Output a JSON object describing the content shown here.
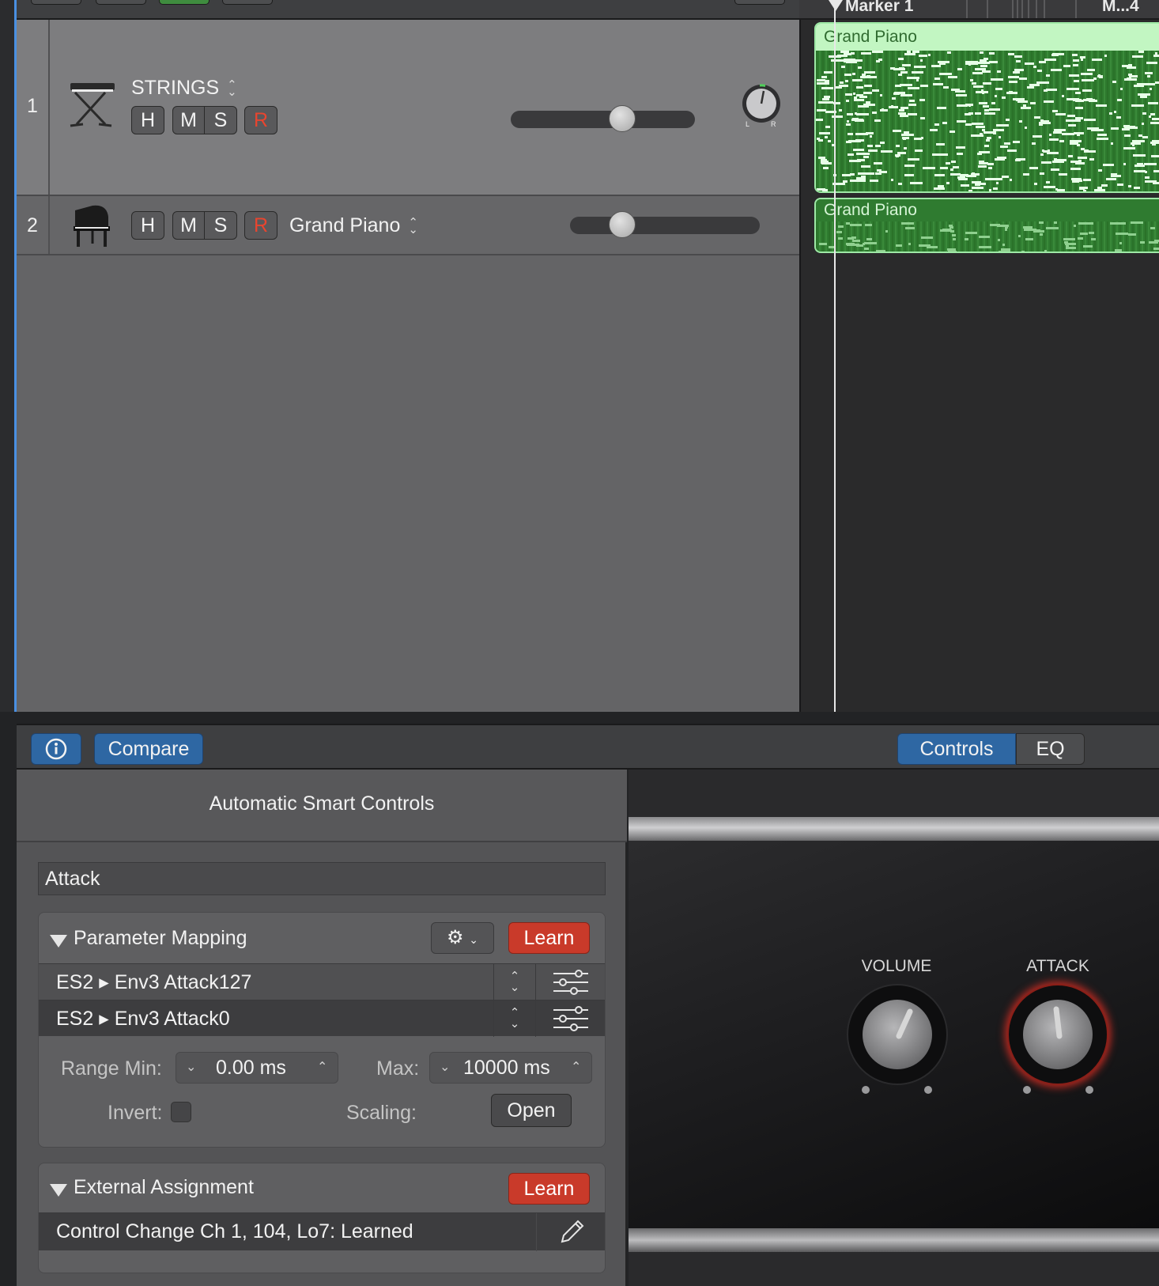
{
  "ruler": {
    "markers": [
      "Marker 1",
      "M...4"
    ]
  },
  "tracks": [
    {
      "number": "1",
      "name": "STRINGS",
      "buttons": {
        "hide": "H",
        "mute": "M",
        "solo": "S",
        "record": "R"
      },
      "pan_labels": {
        "left": "L",
        "right": "R"
      },
      "volume_fraction": 0.61
    },
    {
      "number": "2",
      "name": "Grand Piano",
      "buttons": {
        "hide": "H",
        "mute": "M",
        "solo": "S",
        "record": "R"
      },
      "volume_fraction": 0.28
    }
  ],
  "regions": [
    {
      "name": "Grand Piano"
    },
    {
      "name": "Grand Piano"
    }
  ],
  "smart_controls": {
    "header": {
      "info_icon": "info-icon",
      "compare_label": "Compare",
      "tabs": [
        "Controls",
        "EQ"
      ],
      "active_tab": "Controls"
    },
    "inspector": {
      "title": "Automatic Smart Controls",
      "parameter_name": "Attack",
      "parameter_mapping": {
        "title": "Parameter Mapping",
        "learn_label": "Learn",
        "rows": [
          "ES2 ▸ Env3 Attack127",
          "ES2 ▸ Env3 Attack0"
        ],
        "range_min_label": "Range Min:",
        "range_min_value": "0.00 ms",
        "max_label": "Max:",
        "max_value": "10000 ms",
        "invert_label": "Invert:",
        "scaling_label": "Scaling:",
        "open_label": "Open"
      },
      "external_assignment": {
        "title": "External Assignment",
        "learn_label": "Learn",
        "value": "Control Change Ch 1, 104, Lo7: Learned"
      }
    },
    "panel": {
      "knobs": [
        {
          "label": "VOLUME"
        },
        {
          "label": "ATTACK",
          "selected": true
        }
      ]
    }
  },
  "colors": {
    "accent_blue": "#2e67a3",
    "learn_red": "#c93a2a",
    "region_green": "#2e7a2e",
    "region_header": "#c2f6c2"
  }
}
